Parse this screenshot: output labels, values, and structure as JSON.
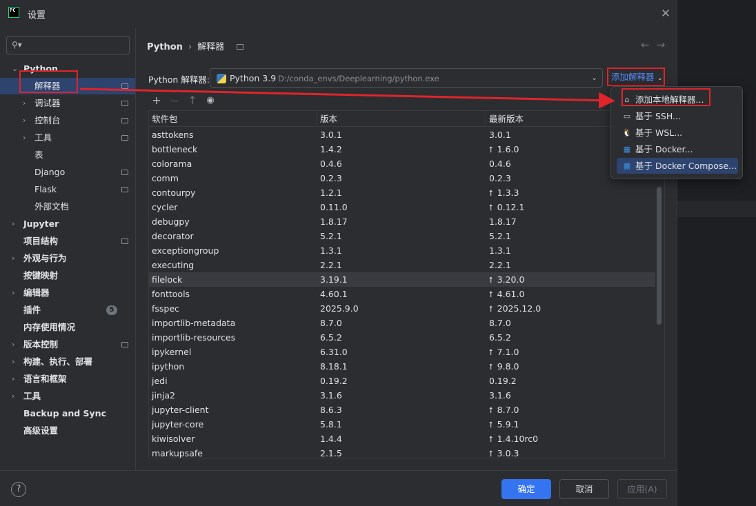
{
  "window": {
    "app_icon_text": "PC",
    "title": "设置",
    "close_glyph": "✕"
  },
  "sidebar": {
    "search_glyph": "⚲▾",
    "items": [
      {
        "label": "Python",
        "bold": true,
        "expanded": true,
        "arrow": "⌄"
      },
      {
        "label": "解释器",
        "selected": true,
        "pin": true
      },
      {
        "label": "调试器",
        "arrow": "›",
        "pin": true
      },
      {
        "label": "控制台",
        "arrow": "›",
        "pin": true
      },
      {
        "label": "工具",
        "arrow": "›",
        "pin": true
      },
      {
        "label": "表"
      },
      {
        "label": "Django",
        "pin": true
      },
      {
        "label": "Flask",
        "pin": true
      },
      {
        "label": "外部文档"
      },
      {
        "label": "Jupyter",
        "bold": true,
        "arrow": "›"
      },
      {
        "label": "项目结构",
        "bold": true,
        "pin": true
      },
      {
        "label": "外观与行为",
        "bold": true,
        "arrow": "›"
      },
      {
        "label": "按键映射",
        "bold": true
      },
      {
        "label": "编辑器",
        "bold": true,
        "arrow": "›"
      },
      {
        "label": "插件",
        "bold": true,
        "badge": "5"
      },
      {
        "label": "内存使用情况",
        "bold": true
      },
      {
        "label": "版本控制",
        "bold": true,
        "arrow": "›",
        "pin": true
      },
      {
        "label": "构建、执行、部署",
        "bold": true,
        "arrow": "›"
      },
      {
        "label": "语言和框架",
        "bold": true,
        "arrow": "›"
      },
      {
        "label": "工具",
        "bold": true,
        "arrow": "›"
      },
      {
        "label": "Backup and Sync",
        "bold": true
      },
      {
        "label": "高级设置",
        "bold": true
      }
    ]
  },
  "header": {
    "breadcrumb_root": "Python",
    "breadcrumb_sep": "›",
    "breadcrumb_leaf": "解释器",
    "nav_back": "←",
    "nav_forward": "→"
  },
  "interpreter": {
    "label": "Python 解释器:",
    "name": "Python 3.9",
    "path": "D:/conda_envs/Deeplearning/python.exe",
    "chevron": "⌄",
    "add_button": "添加解释器",
    "add_chevron": "⌄"
  },
  "toolbar": {
    "add": "+",
    "remove": "—",
    "upgrade": "↑",
    "show": "◉"
  },
  "table": {
    "columns": [
      "软件包",
      "版本",
      "最新版本"
    ],
    "upgrade_glyph": "⭡",
    "rows": [
      {
        "name": "asttokens",
        "version": "3.0.1",
        "latest": "3.0.1",
        "upgrade": false
      },
      {
        "name": "bottleneck",
        "version": "1.4.2",
        "latest": "1.6.0",
        "upgrade": true
      },
      {
        "name": "colorama",
        "version": "0.4.6",
        "latest": "0.4.6",
        "upgrade": false
      },
      {
        "name": "comm",
        "version": "0.2.3",
        "latest": "0.2.3",
        "upgrade": false
      },
      {
        "name": "contourpy",
        "version": "1.2.1",
        "latest": "1.3.3",
        "upgrade": true
      },
      {
        "name": "cycler",
        "version": "0.11.0",
        "latest": "0.12.1",
        "upgrade": true
      },
      {
        "name": "debugpy",
        "version": "1.8.17",
        "latest": "1.8.17",
        "upgrade": false
      },
      {
        "name": "decorator",
        "version": "5.2.1",
        "latest": "5.2.1",
        "upgrade": false
      },
      {
        "name": "exceptiongroup",
        "version": "1.3.1",
        "latest": "1.3.1",
        "upgrade": false
      },
      {
        "name": "executing",
        "version": "2.2.1",
        "latest": "2.2.1",
        "upgrade": false
      },
      {
        "name": "filelock",
        "version": "3.19.1",
        "latest": "3.20.0",
        "upgrade": true,
        "highlight": true
      },
      {
        "name": "fonttools",
        "version": "4.60.1",
        "latest": "4.61.0",
        "upgrade": true
      },
      {
        "name": "fsspec",
        "version": "2025.9.0",
        "latest": "2025.12.0",
        "upgrade": true
      },
      {
        "name": "importlib-metadata",
        "version": "8.7.0",
        "latest": "8.7.0",
        "upgrade": false
      },
      {
        "name": "importlib-resources",
        "version": "6.5.2",
        "latest": "6.5.2",
        "upgrade": false
      },
      {
        "name": "ipykernel",
        "version": "6.31.0",
        "latest": "7.1.0",
        "upgrade": true
      },
      {
        "name": "ipython",
        "version": "8.18.1",
        "latest": "9.8.0",
        "upgrade": true
      },
      {
        "name": "jedi",
        "version": "0.19.2",
        "latest": "0.19.2",
        "upgrade": false
      },
      {
        "name": "jinja2",
        "version": "3.1.6",
        "latest": "3.1.6",
        "upgrade": false
      },
      {
        "name": "jupyter-client",
        "version": "8.6.3",
        "latest": "8.7.0",
        "upgrade": true
      },
      {
        "name": "jupyter-core",
        "version": "5.8.1",
        "latest": "5.9.1",
        "upgrade": true
      },
      {
        "name": "kiwisolver",
        "version": "1.4.4",
        "latest": "1.4.10rc0",
        "upgrade": true
      },
      {
        "name": "markupsafe",
        "version": "2.1.5",
        "latest": "3.0.3",
        "upgrade": true
      }
    ]
  },
  "popup": {
    "items": [
      {
        "label": "添加本地解释器...",
        "icon": "⌂"
      },
      {
        "label": "基于 SSH...",
        "icon": "▭"
      },
      {
        "label": "基于 WSL...",
        "icon": "🐧"
      },
      {
        "label": "基于 Docker...",
        "icon": "▦"
      },
      {
        "label": "基于 Docker Compose...",
        "icon": "▦",
        "selected": true
      }
    ]
  },
  "footer": {
    "help": "?",
    "ok": "确定",
    "cancel": "取消",
    "apply": "应用(A)"
  },
  "colors": {
    "accent": "#3574f0",
    "selection": "#2e436e",
    "annotation_red": "#e0242b",
    "link": "#548af7"
  }
}
